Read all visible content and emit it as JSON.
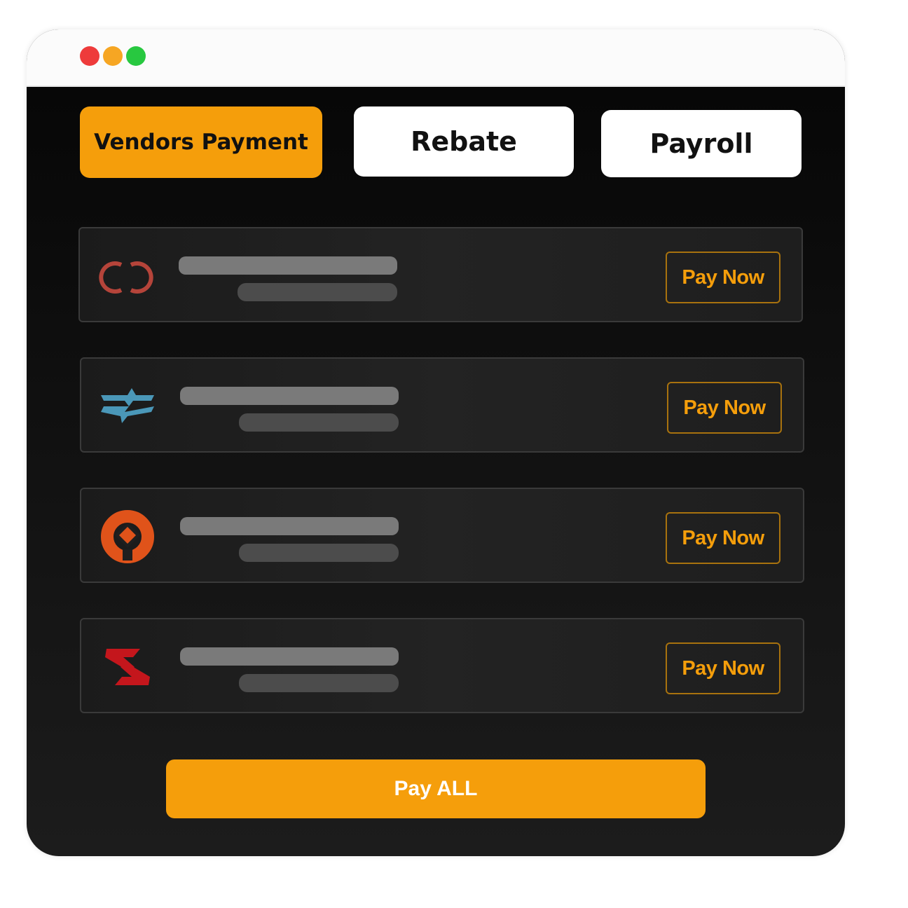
{
  "window": {
    "traffic_lights": {
      "close_color": "#ee3b3b",
      "minimize_color": "#f6a623",
      "zoom_color": "#28c840"
    }
  },
  "tabs": [
    {
      "label": "Vendors Payment",
      "active": true
    },
    {
      "label": "Rebate",
      "active": false
    },
    {
      "label": "Payroll",
      "active": false
    }
  ],
  "vendors": [
    {
      "logo": "double-c-logo",
      "logo_color": "#b5443a",
      "action_label": "Pay Now"
    },
    {
      "logo": "wave-bird-logo",
      "logo_color": "#4a97b8",
      "action_label": "Pay Now"
    },
    {
      "logo": "orange-ring-diamond-logo",
      "logo_color": "#e0531a",
      "action_label": "Pay Now"
    },
    {
      "logo": "red-s-chevron-logo",
      "logo_color": "#c4161c",
      "action_label": "Pay Now"
    }
  ],
  "footer": {
    "pay_all_label": "Pay ALL"
  },
  "colors": {
    "accent": "#f59e0b",
    "pay_now_text": "#f59e0b",
    "tab_active_bg": "#f59e0b",
    "tab_inactive_bg": "#ffffff"
  }
}
